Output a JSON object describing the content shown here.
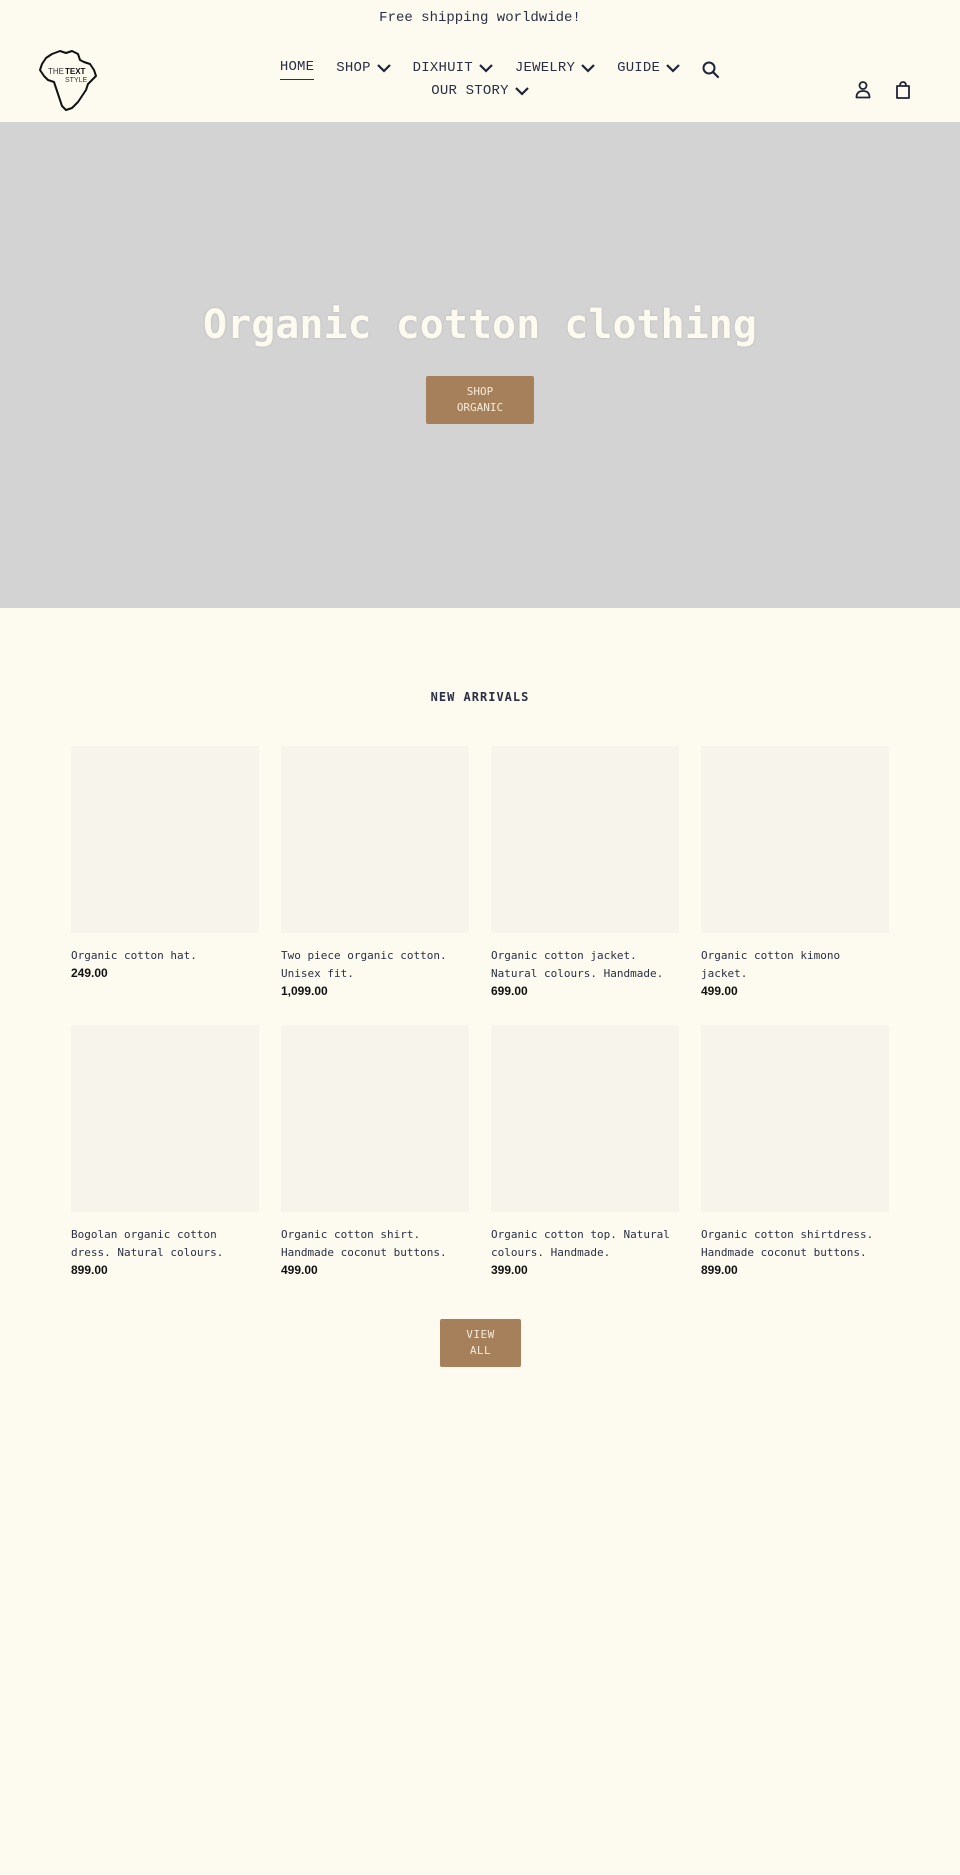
{
  "announcement": {
    "text": "Free shipping worldwide!"
  },
  "header": {
    "logo_alt": "The Text Style",
    "logo_text": {
      "line1_light": "THE",
      "line1_bold": "TEXT",
      "line2": "STYLE"
    },
    "nav": [
      {
        "label": "HOME",
        "dropdown": false,
        "active": true
      },
      {
        "label": "SHOP",
        "dropdown": true
      },
      {
        "label": "DIXHUIT",
        "dropdown": true
      },
      {
        "label": "JEWELRY",
        "dropdown": true
      },
      {
        "label": "GUIDE",
        "dropdown": true
      },
      {
        "label": "OUR STORY",
        "dropdown": true
      }
    ],
    "icons": {
      "search": "search-icon",
      "account": "account-icon",
      "cart": "cart-icon"
    }
  },
  "hero": {
    "title": "Organic cotton clothing",
    "button_line1": "SHOP",
    "button_line2": "ORGANIC"
  },
  "collection": {
    "title": "NEW ARRIVALS",
    "products": [
      {
        "title": "Organic cotton hat.",
        "price": "249.00"
      },
      {
        "title": "Two piece organic cotton. Unisex fit.",
        "price": "1,099.00"
      },
      {
        "title": "Organic cotton jacket. Natural colours. Handmade.",
        "price": "699.00"
      },
      {
        "title": "Organic cotton kimono jacket.",
        "price": "499.00"
      },
      {
        "title": "Bogolan organic cotton dress. Natural colours.",
        "price": "899.00"
      },
      {
        "title": "Organic cotton shirt. Handmade coconut buttons.",
        "price": "499.00"
      },
      {
        "title": "Organic cotton top. Natural colours. Handmade.",
        "price": "399.00"
      },
      {
        "title": "Organic cotton shirtdress. Handmade coconut buttons.",
        "price": "899.00"
      }
    ],
    "view_all_line1": "VIEW",
    "view_all_line2": "ALL"
  },
  "colors": {
    "background": "#fdfbef",
    "text": "#2b2f45",
    "button": "#a67f5b",
    "hero_bg": "#d3d3d3",
    "placeholder": "#f7f5eb"
  }
}
